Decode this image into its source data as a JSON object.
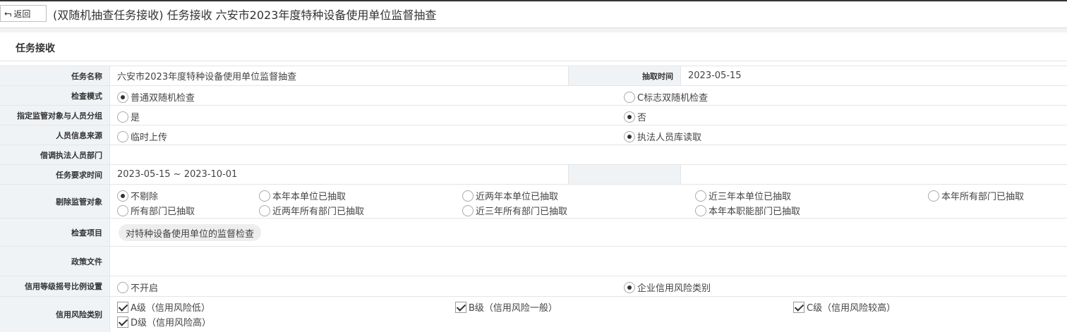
{
  "header": {
    "back_label": "返回",
    "title": "(双随机抽查任务接收) 任务接收 六安市2023年度特种设备使用单位监督抽查"
  },
  "section": {
    "title": "任务接收"
  },
  "form": {
    "task_name": {
      "label": "任务名称",
      "value": "六安市2023年度特种设备使用单位监督抽查"
    },
    "draw_time": {
      "label": "抽取时间",
      "value": "2023-05-15"
    },
    "inspection_mode": {
      "label": "检查模式",
      "options": [
        "普通双随机检查",
        "C标志双随机检查"
      ],
      "selected": "普通双随机检查"
    },
    "assign_grouping": {
      "label": "指定监管对象与人员分组",
      "options": [
        "是",
        "否"
      ],
      "selected": "否"
    },
    "personnel_source": {
      "label": "人员信息来源",
      "options": [
        "临时上传",
        "执法人员库读取"
      ],
      "selected": "执法人员库读取"
    },
    "seconded_dept": {
      "label": "借调执法人员部门",
      "value": ""
    },
    "task_time": {
      "label": "任务要求时间",
      "value": "2023-05-15 ~ 2023-10-01"
    },
    "exclude": {
      "label": "剔除监管对象",
      "options": [
        "不剔除",
        "本年本单位已抽取",
        "近两年本单位已抽取",
        "近三年本单位已抽取",
        "本年所有部门已抽取",
        "所有部门已抽取",
        "近两年所有部门已抽取",
        "近三年所有部门已抽取",
        "本年本职能部门已抽取"
      ],
      "selected": "不剔除"
    },
    "check_items": {
      "label": "检查项目",
      "tag": "对特种设备使用单位的监督检查"
    },
    "policy_docs": {
      "label": "政策文件",
      "value": ""
    },
    "credit_ratio": {
      "label": "信用等级摇号比例设置",
      "options": [
        "不开启",
        "企业信用风险类别"
      ],
      "selected": "企业信用风险类别"
    },
    "credit_risk": {
      "label": "信用风险类别",
      "options": [
        "A级（信用风险低）",
        "B级（信用风险一般）",
        "C级（信用风险较高）",
        "D级（信用风险高）"
      ],
      "checked": [
        true,
        true,
        true,
        true
      ]
    }
  }
}
